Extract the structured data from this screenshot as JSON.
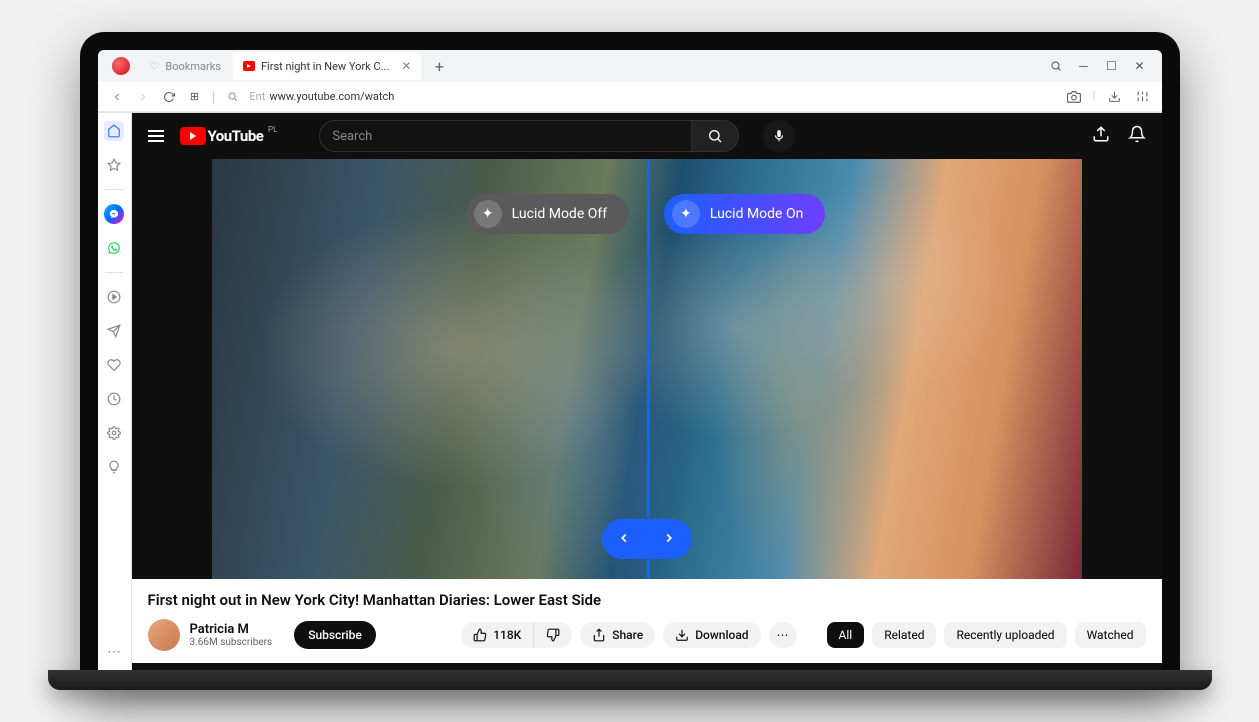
{
  "browser": {
    "bookmarks_label": "Bookmarks",
    "tab_title": "First night in New York C...",
    "url_prefix": "Ent",
    "url": "www.youtube.com/watch"
  },
  "youtube_header": {
    "logo_text": "YouTube",
    "region": "PL",
    "search_placeholder": "Search"
  },
  "lucid": {
    "off_label": "Lucid Mode Off",
    "on_label": "Lucid Mode On"
  },
  "video": {
    "title": "First night out in New York City! Manhattan Diaries: Lower East Side",
    "channel_name": "Patricia M",
    "subscribers": "3.66M subscribers",
    "subscribe_label": "Subscribe",
    "likes": "118K",
    "share_label": "Share",
    "download_label": "Download"
  },
  "chips": {
    "all": "All",
    "related": "Related",
    "recent": "Recently uploaded",
    "watched": "Watched"
  }
}
